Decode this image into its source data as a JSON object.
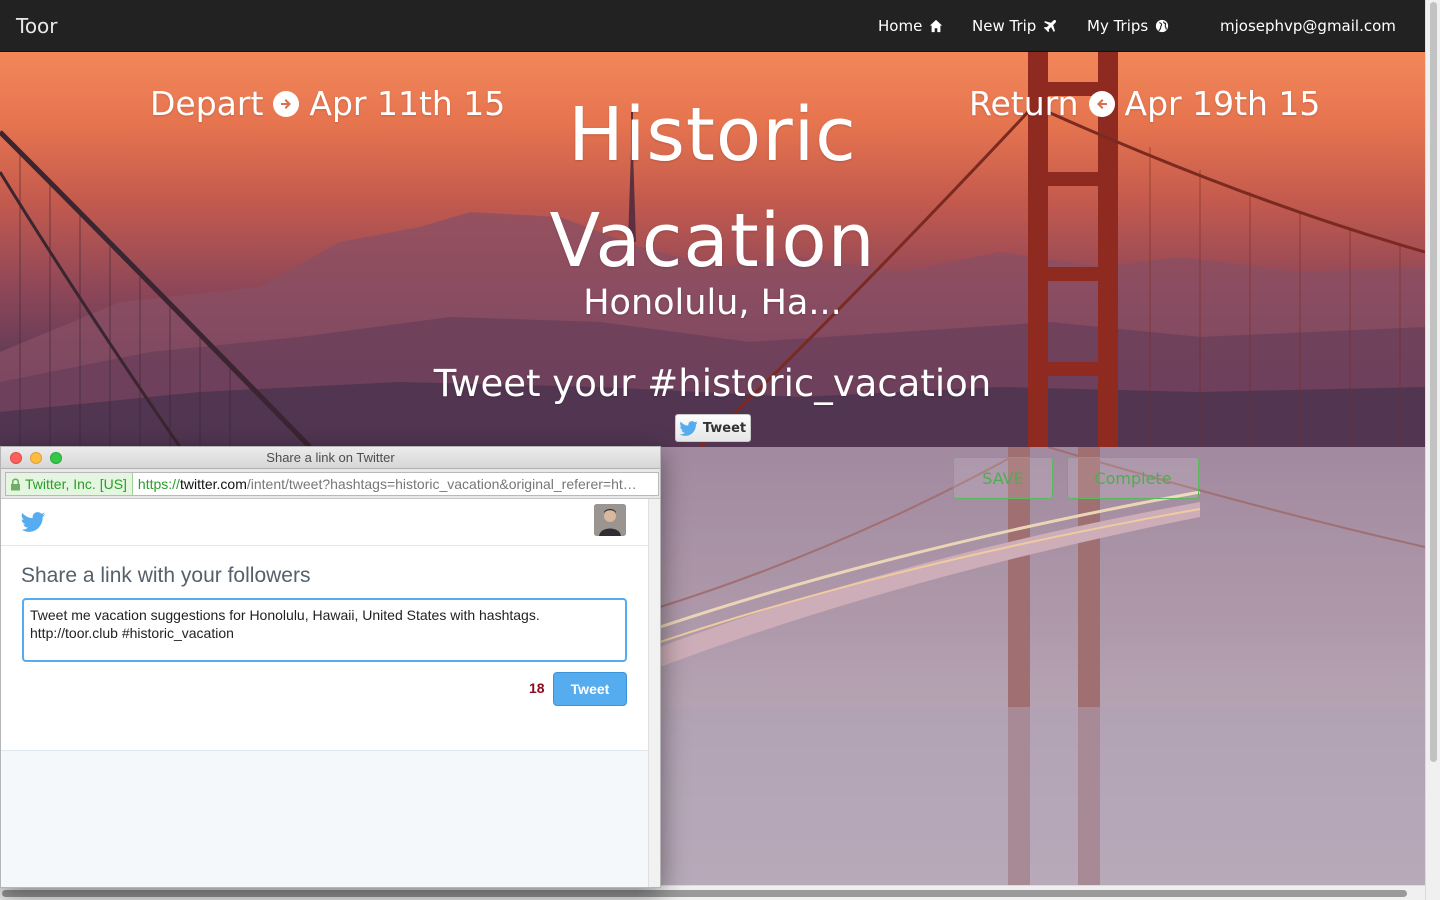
{
  "navbar": {
    "brand": "Toor",
    "links": [
      {
        "label": "Home",
        "icon": "home-icon"
      },
      {
        "label": "New Trip",
        "icon": "plane-icon"
      },
      {
        "label": "My Trips",
        "icon": "globe-icon"
      }
    ],
    "user_email": "mjosephvp@gmail.com"
  },
  "hero": {
    "depart_label": "Depart",
    "depart_date": "Apr 11th 15",
    "return_label": "Return",
    "return_date": "Apr 19th 15",
    "trip_title": "Historic Vacation",
    "location": "Honolulu, Ha...",
    "tweet_prompt": "Tweet your #historic_vacation",
    "tweet_button": "Tweet"
  },
  "actions": {
    "save_label": "SAVE",
    "complete_label": "Complete",
    "color": "#5cb85c"
  },
  "popup": {
    "window_title": "Share a link on Twitter",
    "ev_cert": "Twitter, Inc. [US]",
    "url_scheme": "https://",
    "url_host": "twitter.com",
    "url_rest": "/intent/tweet?hashtags=historic_vacation&original_referer=ht…",
    "share_heading": "Share a link with your followers",
    "tweet_text": "Tweet me vacation suggestions for Honolulu, Hawaii, United States with hashtags. http://toor.club #historic_vacation",
    "char_count": "18",
    "submit_label": "Tweet",
    "accent_color": "#55acee"
  }
}
